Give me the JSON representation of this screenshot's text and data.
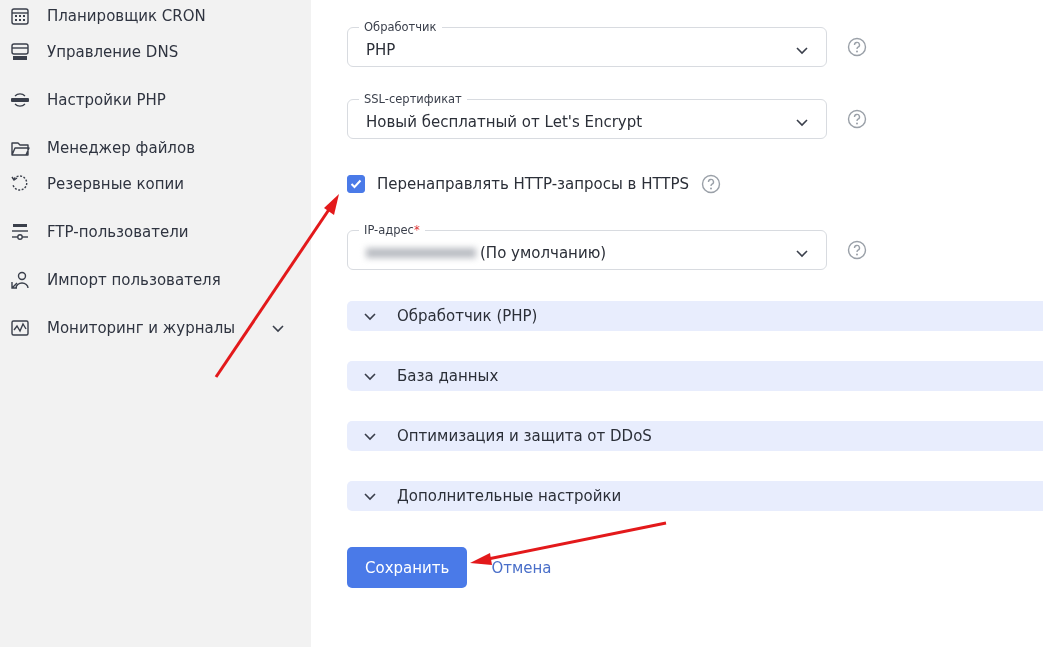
{
  "sidebar": {
    "items": [
      {
        "label": "Планировщик CRON"
      },
      {
        "label": "Управление DNS"
      },
      {
        "label": "Настройки PHP"
      },
      {
        "label": "Менеджер файлов"
      },
      {
        "label": "Резервные копии"
      },
      {
        "label": "FTP-пользователи"
      },
      {
        "label": "Импорт пользователя"
      },
      {
        "label": "Мониторинг и журналы",
        "expanded": false
      }
    ]
  },
  "form": {
    "fields": [
      {
        "label": "Обработчик",
        "value": "PHP"
      },
      {
        "label": "SSL-сертификат",
        "value": "Новый бесплатный от Let's Encrypt"
      },
      {
        "kind": "checkbox",
        "label": "Перенаправлять HTTP-запросы в HTTPS",
        "checked": true
      },
      {
        "label": "IP-адрес",
        "required_mark": "*",
        "value": "(По умолчанию)",
        "redacted": true
      }
    ],
    "sections": [
      {
        "title": "Обработчик (PHP)",
        "expanded": false
      },
      {
        "title": "База данных",
        "expanded": false
      },
      {
        "title": "Оптимизация и защита от DDoS",
        "expanded": false
      },
      {
        "title": "Дополнительные настройки",
        "expanded": false
      }
    ],
    "save_button": "Сохранить",
    "cancel_link": "Отмена"
  }
}
